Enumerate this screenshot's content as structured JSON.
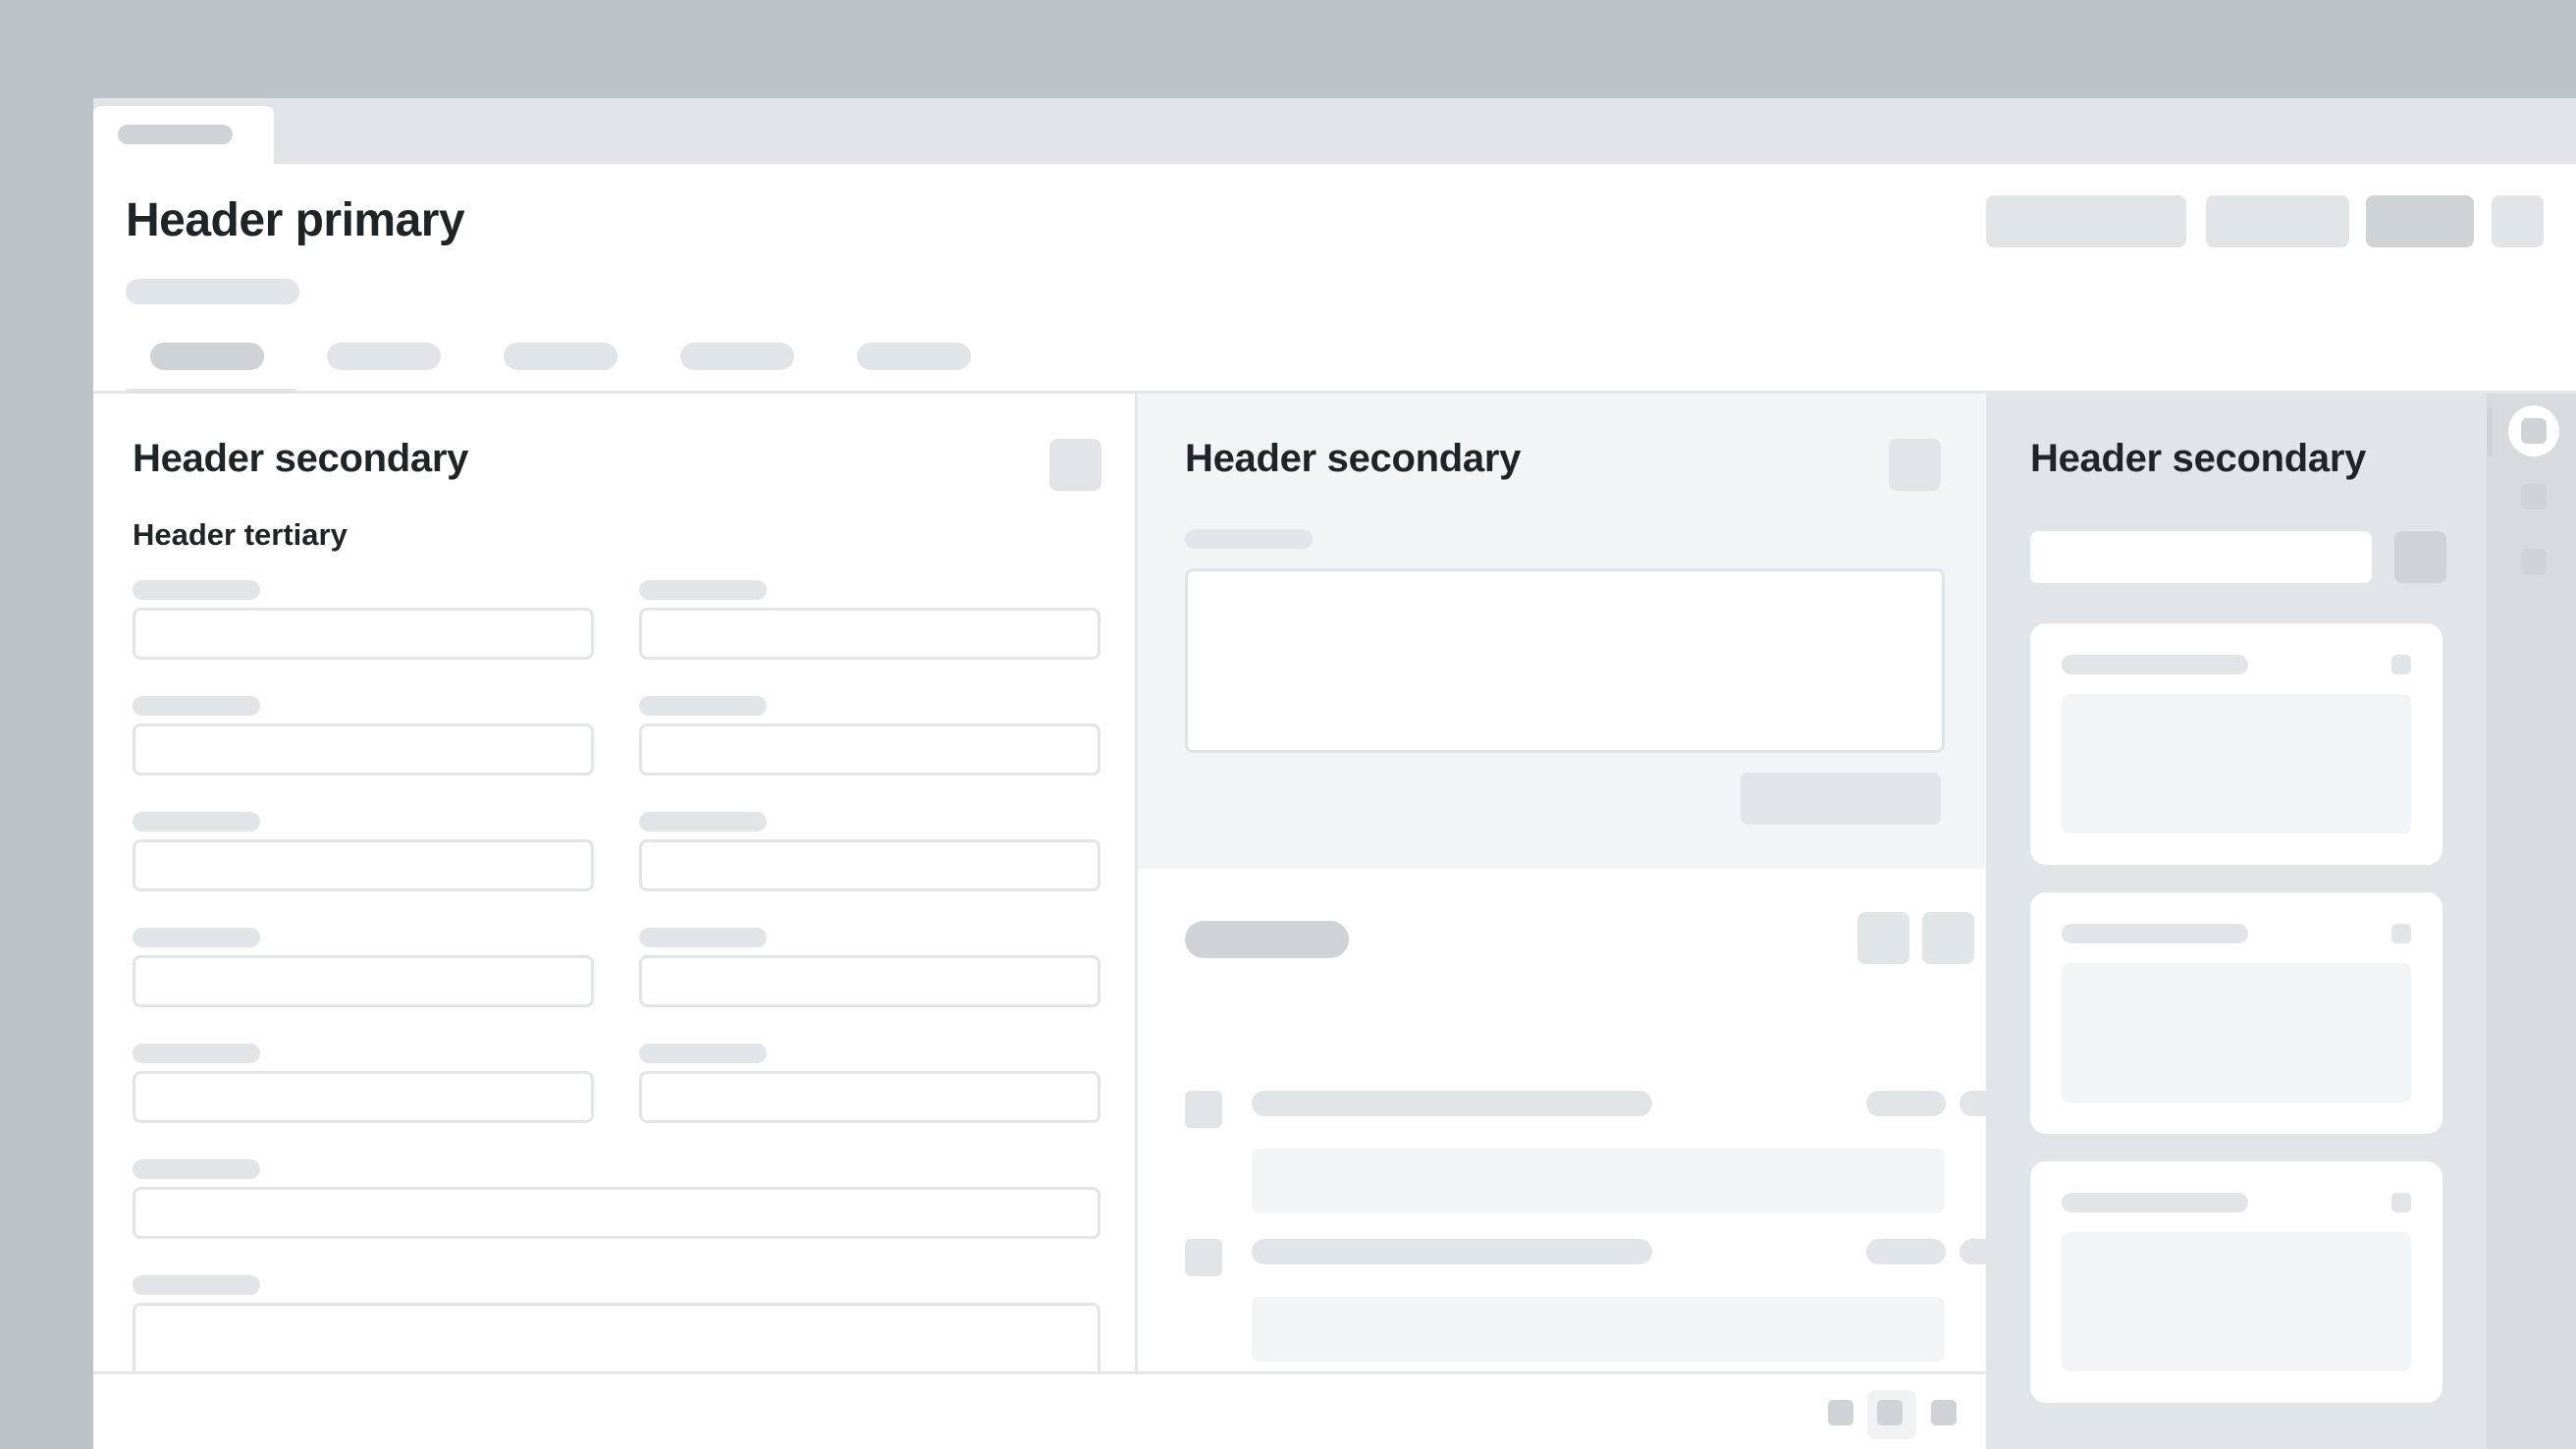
{
  "header": {
    "title": "Header primary"
  },
  "panels": {
    "left": {
      "title": "Header secondary",
      "subtitle": "Header tertiary"
    },
    "middle": {
      "title": "Header secondary"
    },
    "right": {
      "title": "Header secondary"
    }
  },
  "colors": {
    "background": "#bcc3c7",
    "surface": "#ffffff",
    "placeholder": "#e2e5e7",
    "placeholder_dark": "#cfd3d6",
    "text": "#1f2427"
  }
}
